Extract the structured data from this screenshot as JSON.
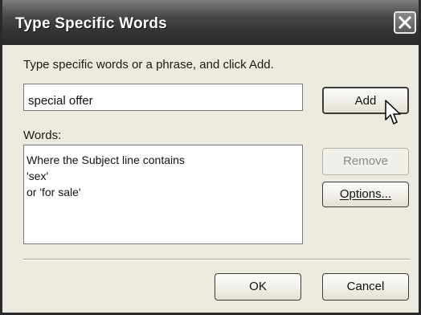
{
  "window": {
    "title": "Type Specific Words"
  },
  "instructions": "Type specific words or a phrase, and click Add.",
  "phrase_input": {
    "value": "special offer"
  },
  "words": {
    "label": "Words:",
    "lines": [
      "Where the Subject line contains",
      "'sex'",
      "or 'for sale'"
    ]
  },
  "buttons": {
    "add": "Add",
    "remove": "Remove",
    "options": "Options...",
    "ok": "OK",
    "cancel": "Cancel"
  },
  "icons": {
    "close": "close-icon",
    "cursor": "mouse-pointer-icon"
  },
  "colors": {
    "titlebar": "#333333",
    "dialog_bg": "#ece9df",
    "disabled_text": "#8a8a8a"
  }
}
